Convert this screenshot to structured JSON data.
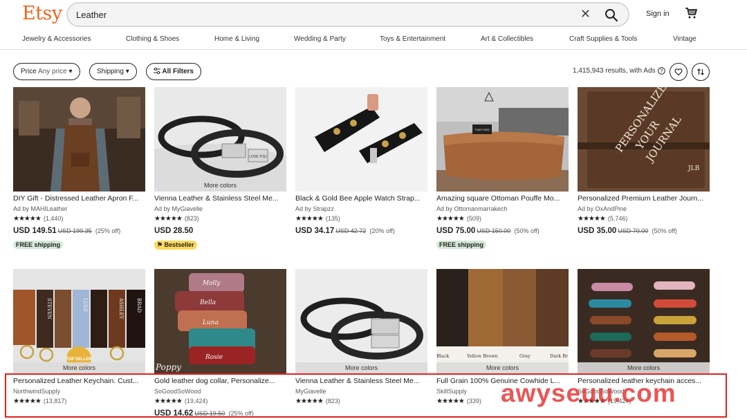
{
  "header": {
    "logo": "Etsy",
    "search_value": "Leather",
    "signin": "Sign in"
  },
  "categories": [
    "Jewelry & Accessories",
    "Clothing & Shoes",
    "Home & Living",
    "Wedding & Party",
    "Toys & Entertainment",
    "Art & Collectibles",
    "Craft Supplies & Tools",
    "Vintage"
  ],
  "filters": {
    "price_label": "Price",
    "price_value": "Any price",
    "shipping": "Shipping",
    "all_filters": "All Filters",
    "results": "1,415,943 results, with Ads"
  },
  "colors": {
    "accent": "#f1641e",
    "free_shipping_bg": "#d4e9d7",
    "bestseller_bg": "#fdd95c",
    "frame": "#e0221c"
  },
  "products": [
    {
      "title": "DIY Gift - Distressed Leather Apron F...",
      "seller": "Ad by MAHILeather",
      "stars": "★★★★★",
      "reviews": "(1,440)",
      "price": "USD 149.51",
      "orig": "USD 199.35",
      "discount": "(25% off)",
      "badge": "FREE shipping",
      "more_colors": ""
    },
    {
      "title": "Vienna Leather & Stainless Steel Me...",
      "seller": "Ad by MyGiavelle",
      "stars": "★★★★★",
      "reviews": "(823)",
      "price": "USD 28.50",
      "orig": "",
      "discount": "",
      "badge": "Bestseller",
      "more_colors": "More colors"
    },
    {
      "title": "Black & Gold Bee Apple Watch Strap...",
      "seller": "Ad by Strapzz",
      "stars": "★★★★★",
      "reviews": "(135)",
      "price": "USD 34.17",
      "orig": "USD 42.72",
      "discount": "(20% off)",
      "badge": "",
      "more_colors": ""
    },
    {
      "title": "Amazing square Ottoman Pouffe Mo...",
      "seller": "Ad by Ottomanmarrakech",
      "stars": "★★★★★",
      "reviews": "(509)",
      "price": "USD 75.00",
      "orig": "USD 150.00",
      "discount": "(50% off)",
      "badge": "FREE shipping",
      "more_colors": ""
    },
    {
      "title": "Personalized Premium Leather Journ...",
      "seller": "Ad by OxAndPine",
      "stars": "★★★★★",
      "reviews": "(5,746)",
      "price": "USD 35.00",
      "orig": "USD 70.00",
      "discount": "(50% off)",
      "badge": "",
      "more_colors": ""
    },
    {
      "title": "Personalized Leather Keychain. Cust...",
      "seller": "NorthwindSupply",
      "stars": "★★★★★",
      "reviews": "(13,817)",
      "price": "",
      "orig": "",
      "discount": "",
      "badge": "",
      "more_colors": "More colors"
    },
    {
      "title": "Gold leather dog collar, Personalize...",
      "seller": "SoGoodSoWood",
      "stars": "★★★★★",
      "reviews": "(19,424)",
      "price": "USD 14.62",
      "orig": "USD 19.50",
      "discount": "(25% off)",
      "badge": "",
      "more_colors": ""
    },
    {
      "title": "Vienna Leather & Stainless Steel Me...",
      "seller": "MyGiavelle",
      "stars": "★★★★★",
      "reviews": "(823)",
      "price": "",
      "orig": "",
      "discount": "",
      "badge": "",
      "more_colors": "More colors"
    },
    {
      "title": "Full Grain 100% Genuine Cowhide L...",
      "seller": "SkillSupply",
      "stars": "★★★★★",
      "reviews": "(339)",
      "price": "",
      "orig": "",
      "discount": "",
      "badge": "",
      "more_colors": "More colors"
    },
    {
      "title": "Personalized leather keychain acces...",
      "seller": "SoGoodSoWood",
      "stars": "★★★★★",
      "reviews": "(19,424)",
      "price": "",
      "orig": "",
      "discount": "",
      "badge": "",
      "more_colors": "More colors"
    }
  ],
  "image_text": {
    "keychain_names": [
      "STEVEN",
      "LUKE",
      "ASHLEY",
      "BRAD"
    ],
    "top_seller": "TOP SELLER",
    "collar_names": [
      "Molly",
      "Bella",
      "Luna",
      "Rosie",
      "Poppy"
    ],
    "bracelet_plate": "LOVE YOU",
    "leather_swatches": [
      "Black",
      "Yellow Brown",
      "Gray",
      "Dark Br"
    ],
    "journal_words": [
      "PERSONALIZE",
      "YOUR",
      "JOURNAL",
      "JLB"
    ],
    "table_book": "TOM FORD"
  },
  "watermark": "awyseuu.com"
}
